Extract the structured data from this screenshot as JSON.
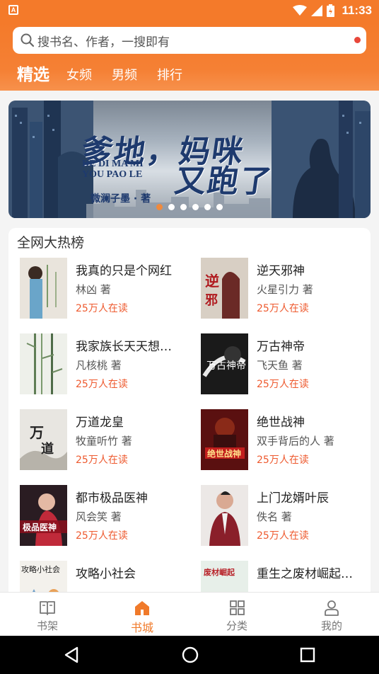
{
  "status_bar": {
    "time": "11:33",
    "app_badge": "A"
  },
  "search": {
    "placeholder": "搜书名、作者，一搜即有"
  },
  "tabs": [
    {
      "label": "精选",
      "active": true
    },
    {
      "label": "女频",
      "active": false
    },
    {
      "label": "男频",
      "active": false
    },
    {
      "label": "排行",
      "active": false
    }
  ],
  "banner": {
    "title_line1": "爹地，妈咪",
    "title_line2": "又跑了",
    "pinyin_line1": "DE DI MA MI",
    "pinyin_line2": "YOU PAO LE",
    "author": "微澜子墨 · 著",
    "dot_count": 6,
    "active_dot": 0
  },
  "ranking": {
    "title": "全网大热榜",
    "books": [
      {
        "name": "我真的只是个网红",
        "author": "林凶 著",
        "reads": "25万人在读",
        "cover": "cover-1"
      },
      {
        "name": "逆天邪神",
        "author": "火星引力 著",
        "reads": "25万人在读",
        "cover": "cover-2"
      },
      {
        "name": "我家族长天天想…",
        "author": "凡核桃 著",
        "reads": "25万人在读",
        "cover": "cover-3"
      },
      {
        "name": "万古神帝",
        "author": "飞天鱼 著",
        "reads": "25万人在读",
        "cover": "cover-4"
      },
      {
        "name": "万道龙皇",
        "author": "牧童听竹 著",
        "reads": "25万人在读",
        "cover": "cover-5"
      },
      {
        "name": "绝世战神",
        "author": "双手背后的人 著",
        "reads": "25万人在读",
        "cover": "cover-6"
      },
      {
        "name": "都市极品医神",
        "author": "风会笑 著",
        "reads": "25万人在读",
        "cover": "cover-7"
      },
      {
        "name": "上门龙婿叶辰",
        "author": "佚名 著",
        "reads": "25万人在读",
        "cover": "cover-8"
      },
      {
        "name": "攻略小社会",
        "author": "",
        "reads": "",
        "cover": "cover-9"
      },
      {
        "name": "重生之废材崛起…",
        "author": "",
        "reads": "",
        "cover": "cover-10"
      }
    ]
  },
  "bottom_nav": [
    {
      "label": "书架",
      "icon": "bookshelf-icon",
      "active": false
    },
    {
      "label": "书城",
      "icon": "store-icon",
      "active": true
    },
    {
      "label": "分类",
      "icon": "category-icon",
      "active": false
    },
    {
      "label": "我的",
      "icon": "profile-icon",
      "active": false
    }
  ],
  "colors": {
    "accent": "#f47a2a",
    "reads": "#ee5a2f",
    "active_dot": "#f08a3c"
  }
}
